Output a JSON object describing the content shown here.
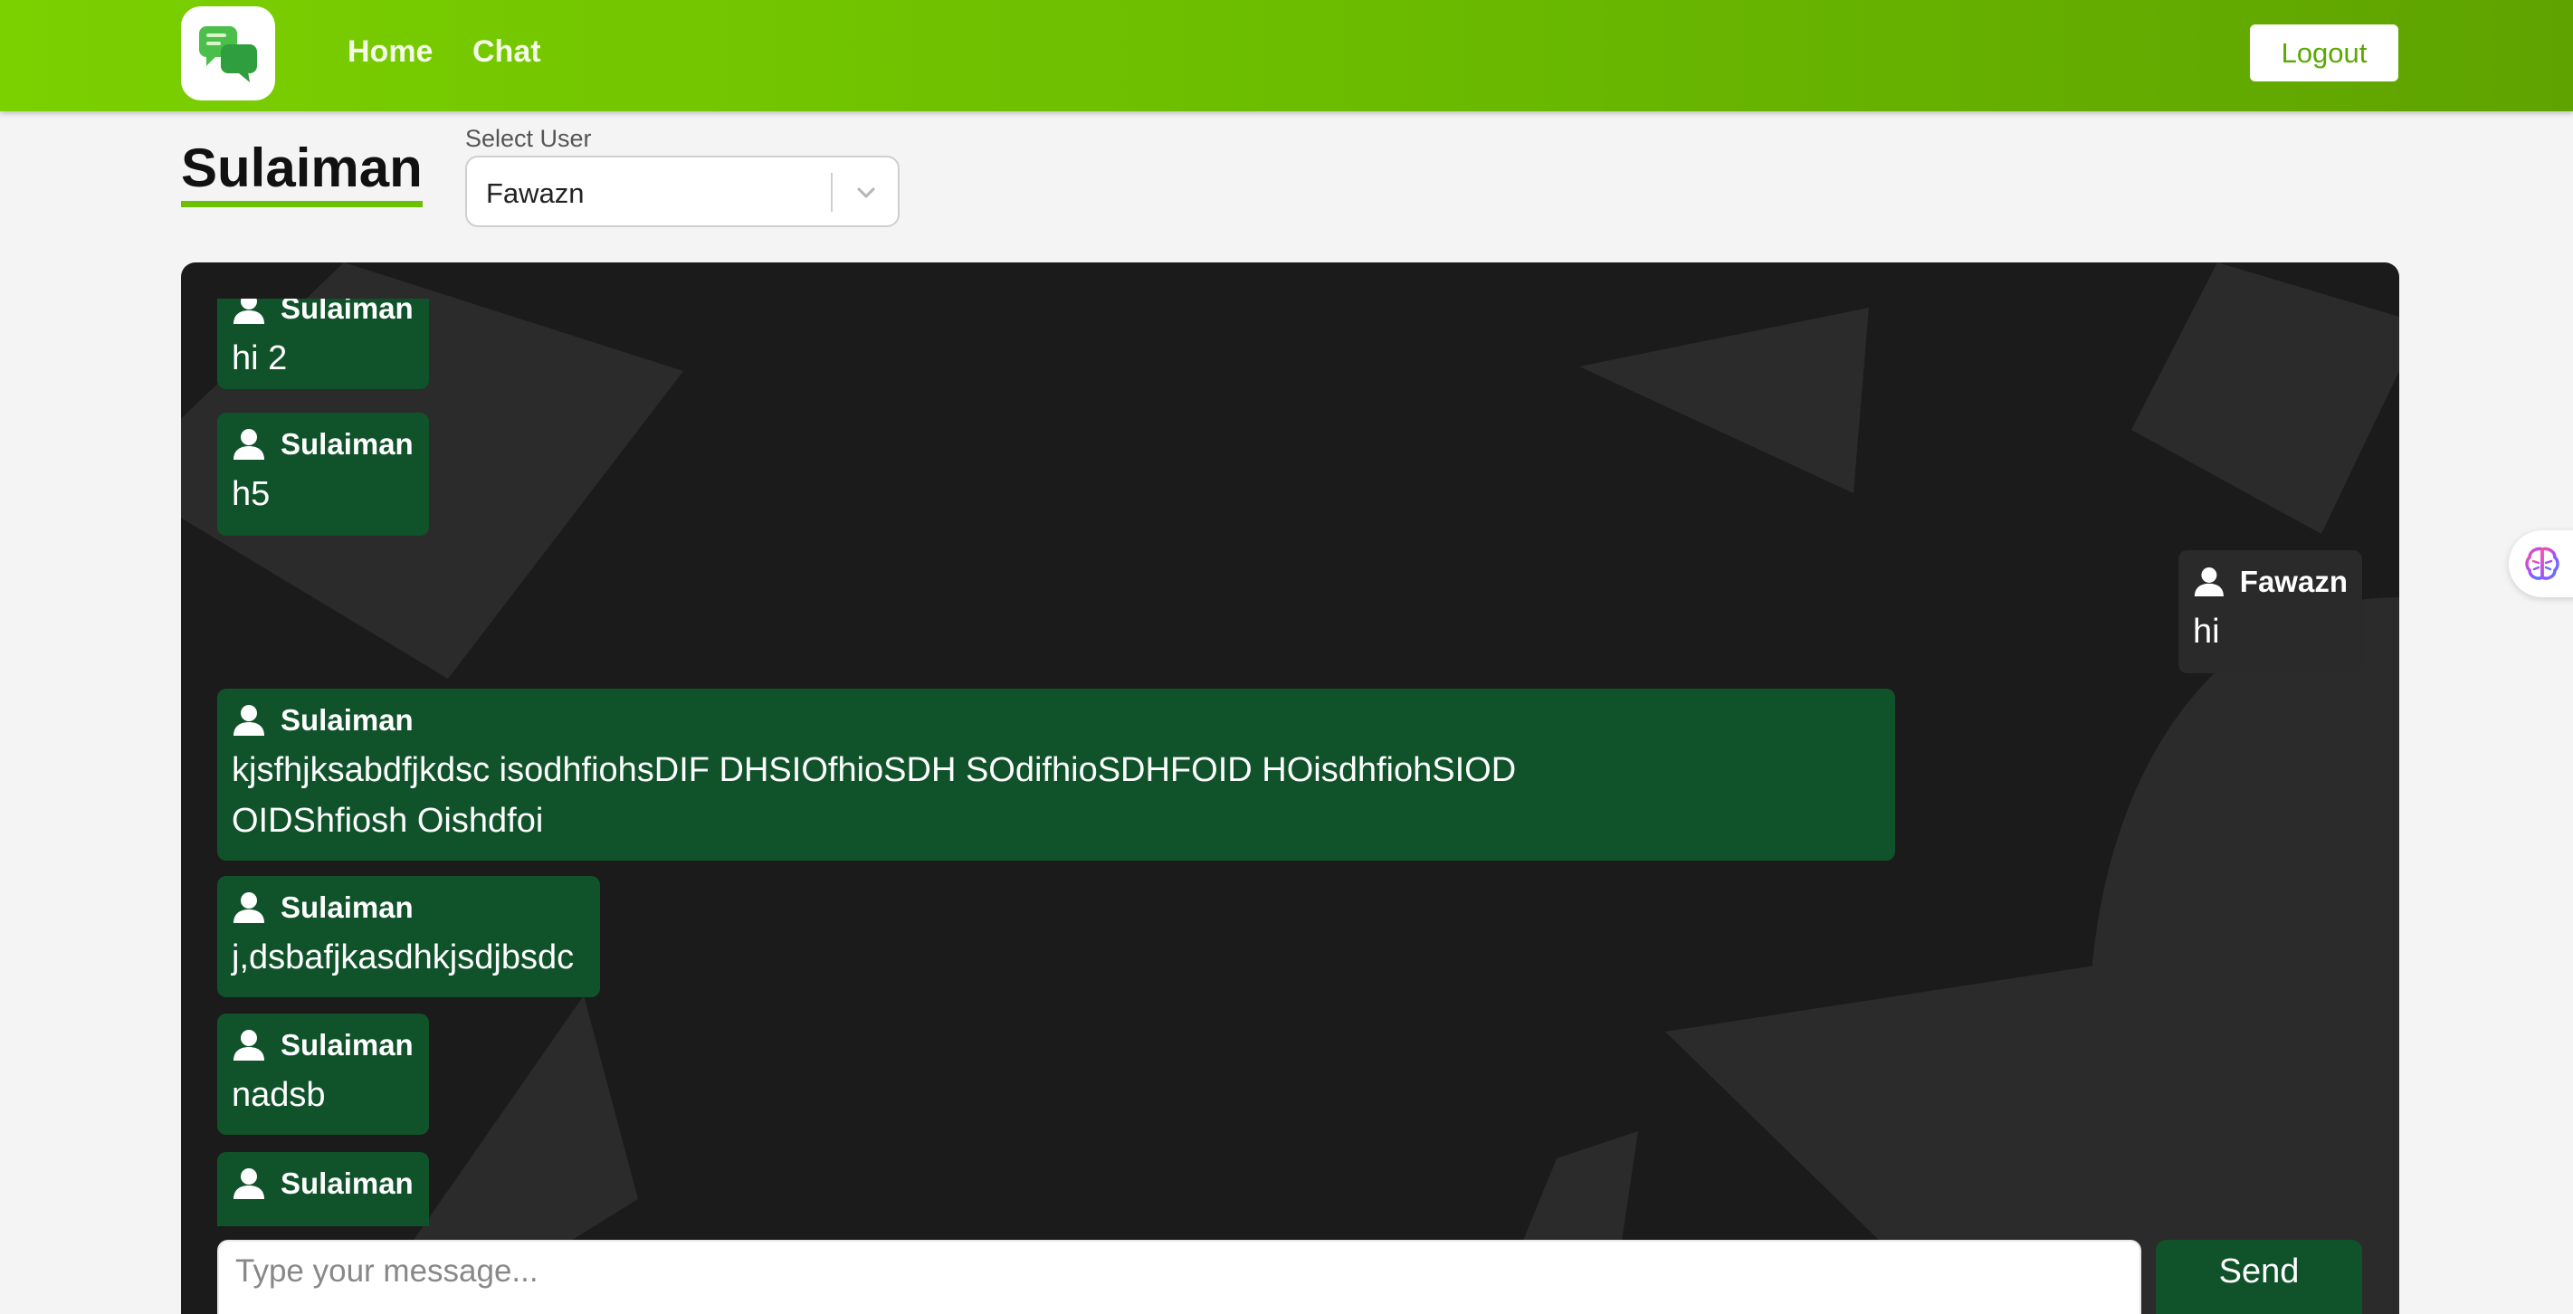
{
  "nav": {
    "links": [
      {
        "label": "Home"
      },
      {
        "label": "Chat"
      }
    ],
    "logout_label": "Logout"
  },
  "header": {
    "title": "Sulaiman",
    "select_label": "Select User",
    "selected_user": "Fawazn"
  },
  "messages": [
    {
      "sender": "Sulaiman",
      "text": "hi 2",
      "side": "mine"
    },
    {
      "sender": "Sulaiman",
      "text": "h5",
      "side": "mine"
    },
    {
      "sender": "Fawazn",
      "text": "hi",
      "side": "theirs"
    },
    {
      "sender": "Sulaiman",
      "text": "kjsfhjksabdfjkdsc isodhfiohsDIF DHSIOfhioSDH SOdifhioSDHFOID HOisdhfiohSIOD OIDShfiosh Oishdfoi",
      "side": "mine"
    },
    {
      "sender": "Sulaiman",
      "text": "j,dsbafjkasdhkjsdjbsdc",
      "side": "mine"
    },
    {
      "sender": "Sulaiman",
      "text": "nadsb",
      "side": "mine"
    },
    {
      "sender": "Sulaiman",
      "text": "",
      "side": "mine"
    }
  ],
  "composer": {
    "placeholder": "Type your message...",
    "send_label": "Send"
  },
  "colors": {
    "navbar_gradient_start": "#7bd000",
    "navbar_gradient_end": "#5fa300",
    "accent_green": "#6cc000",
    "my_bubble": "#10532a",
    "their_bubble": "#2a2a2a",
    "chat_background": "#1b1b1b"
  },
  "icons": {
    "logo": "chat-bubbles-icon",
    "sender": "user-icon",
    "select": "chevron-down-icon",
    "extension": "brain-icon"
  }
}
